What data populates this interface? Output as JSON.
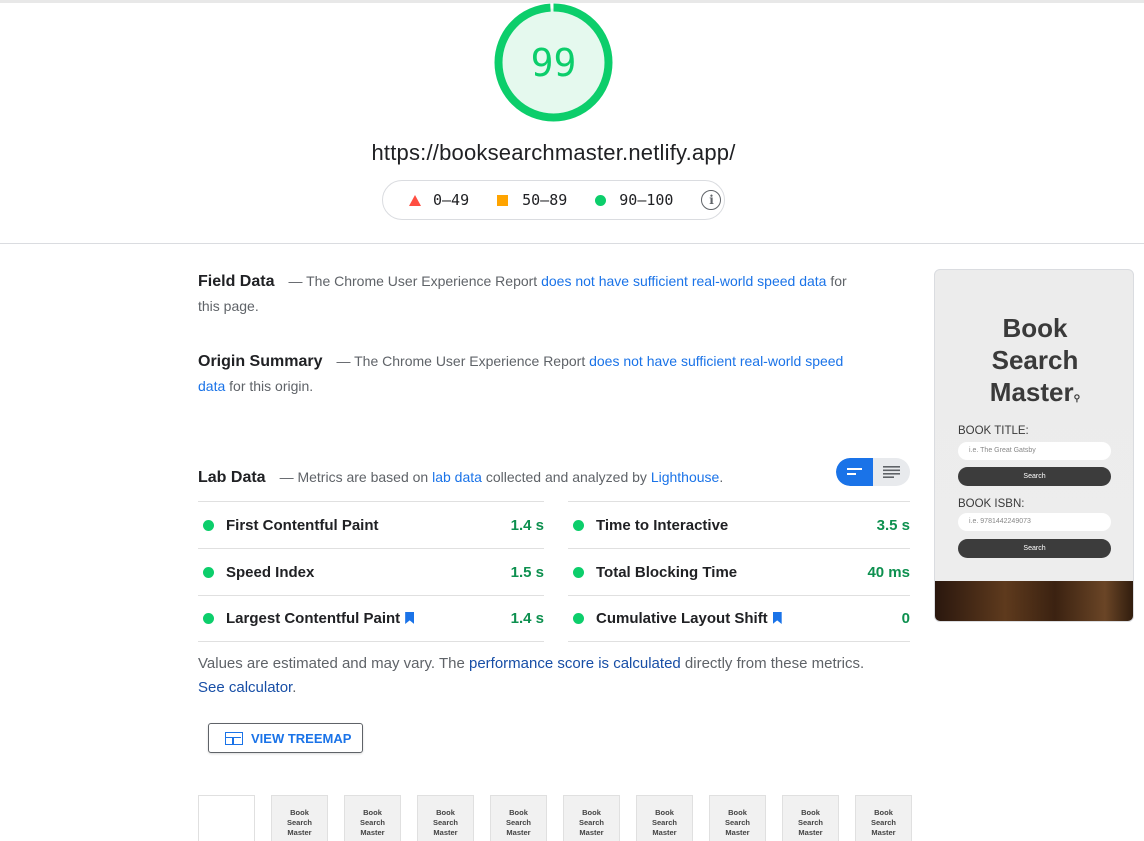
{
  "score": {
    "value": "99",
    "fraction": 0.99,
    "color": "#0cce6b"
  },
  "url": "https://booksearchmaster.netlify.app/",
  "legend": {
    "fail": "0–49",
    "average": "50–89",
    "pass": "90–100",
    "info_icon": "info-icon"
  },
  "field_data": {
    "title": "Field Data",
    "text_before": "— The Chrome User Experience Report",
    "link": "does not have sufficient real-world speed data",
    "text_after": "for this page."
  },
  "origin_summary": {
    "title": "Origin Summary",
    "text_before": "— The Chrome User Experience Report",
    "link": "does not have sufficient real-world speed data",
    "text_after": "for this origin."
  },
  "lab_data": {
    "title": "Lab Data",
    "text_before": "— Metrics are based on",
    "link1": "lab data",
    "text_mid": "collected and analyzed by",
    "link2": "Lighthouse",
    "text_after": "."
  },
  "metrics": {
    "left": [
      {
        "label": "First Contentful Paint",
        "value": "1.4 s"
      },
      {
        "label": "Speed Index",
        "value": "1.5 s"
      },
      {
        "label": "Largest Contentful Paint",
        "value": "1.4 s"
      }
    ],
    "right": [
      {
        "label": "Time to Interactive",
        "value": "3.5 s"
      },
      {
        "label": "Total Blocking Time",
        "value": "40 ms"
      },
      {
        "label": "Cumulative Layout Shift",
        "value": "0"
      }
    ]
  },
  "note": {
    "text_before": "Values are estimated and may vary. The",
    "link1": "performance score is calculated",
    "text_mid": "directly from these metrics.",
    "link2": "See calculator",
    "text_after": "."
  },
  "treemap_button": "VIEW TREEMAP",
  "screenshot": {
    "title_line1": "Book",
    "title_line2": "Search",
    "title_line3": "Master",
    "book_title_label": "BOOK TITLE:",
    "book_title_placeholder": "i.e. The Great Gatsby",
    "search_label_1": "Search",
    "book_isbn_label": "BOOK ISBN:",
    "book_isbn_placeholder": "i.e. 9781442249073",
    "search_label_2": "Search"
  },
  "filmstrip": {
    "frame_title_1": "Book",
    "frame_title_2": "Search",
    "frame_title_3": "Master"
  }
}
